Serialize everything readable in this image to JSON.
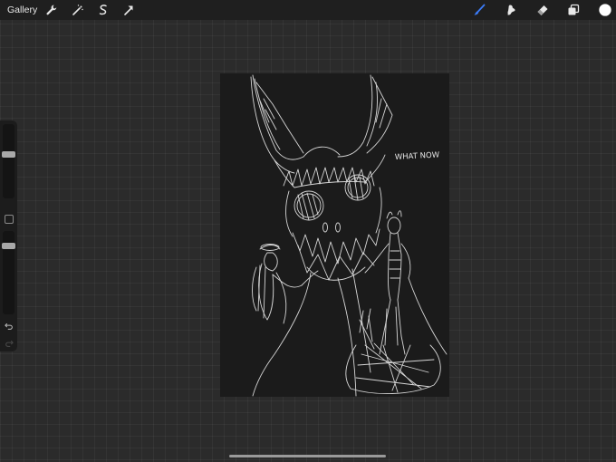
{
  "toolbar": {
    "gallery_label": "Gallery",
    "left_tools": [
      {
        "name": "wrench-icon",
        "label": "Actions"
      },
      {
        "name": "magic-wand-icon",
        "label": "Adjustments"
      },
      {
        "name": "selection-icon",
        "label": "Selection"
      },
      {
        "name": "transform-arrow-icon",
        "label": "Transform"
      }
    ],
    "right_tools": [
      {
        "name": "brush-icon",
        "active": true
      },
      {
        "name": "smudge-icon",
        "active": false
      },
      {
        "name": "eraser-icon",
        "active": false
      },
      {
        "name": "layers-icon",
        "active": false
      }
    ],
    "current_color": "#ffffff",
    "active_tool_color": "#3b7bf7"
  },
  "sidebar": {
    "brush_size_level": 0.6,
    "opacity_level": 0.85
  },
  "canvas": {
    "background_color": "#1b1b1b",
    "stroke_color": "#e6e6e6",
    "text_annotation": "WHAT NOW"
  }
}
